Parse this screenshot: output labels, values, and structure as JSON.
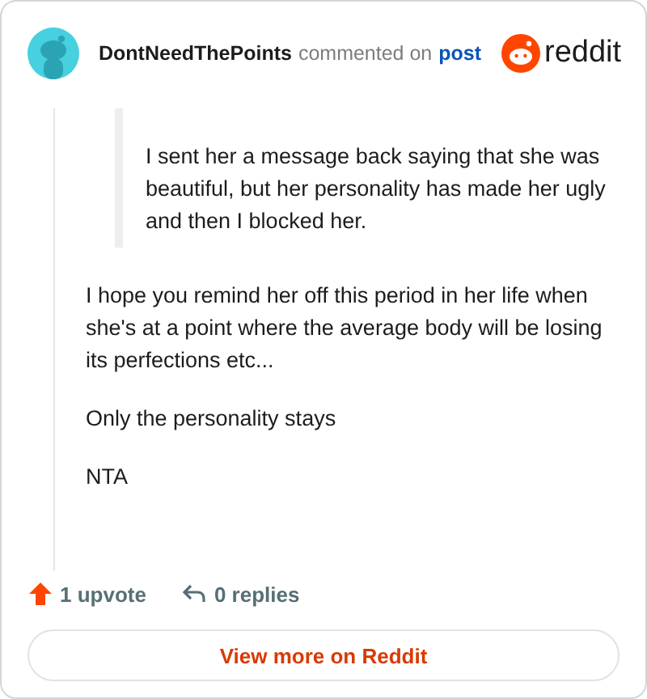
{
  "comment": {
    "author": "DontNeedThePoints",
    "action": "commented on",
    "link": "post",
    "brand": "reddit",
    "quote": [
      "I sent her a message back saying that she was beautiful, but her personality has made her ugly and then I blocked her."
    ],
    "paragraphs": [
      "I hope you remind her off this period in her life when she's at a point where the average body will be losing its perfections etc...",
      "Only the personality stays",
      "NTA"
    ],
    "upvotes": "1 upvote",
    "replies": "0 replies"
  },
  "button": "View more on Reddit"
}
